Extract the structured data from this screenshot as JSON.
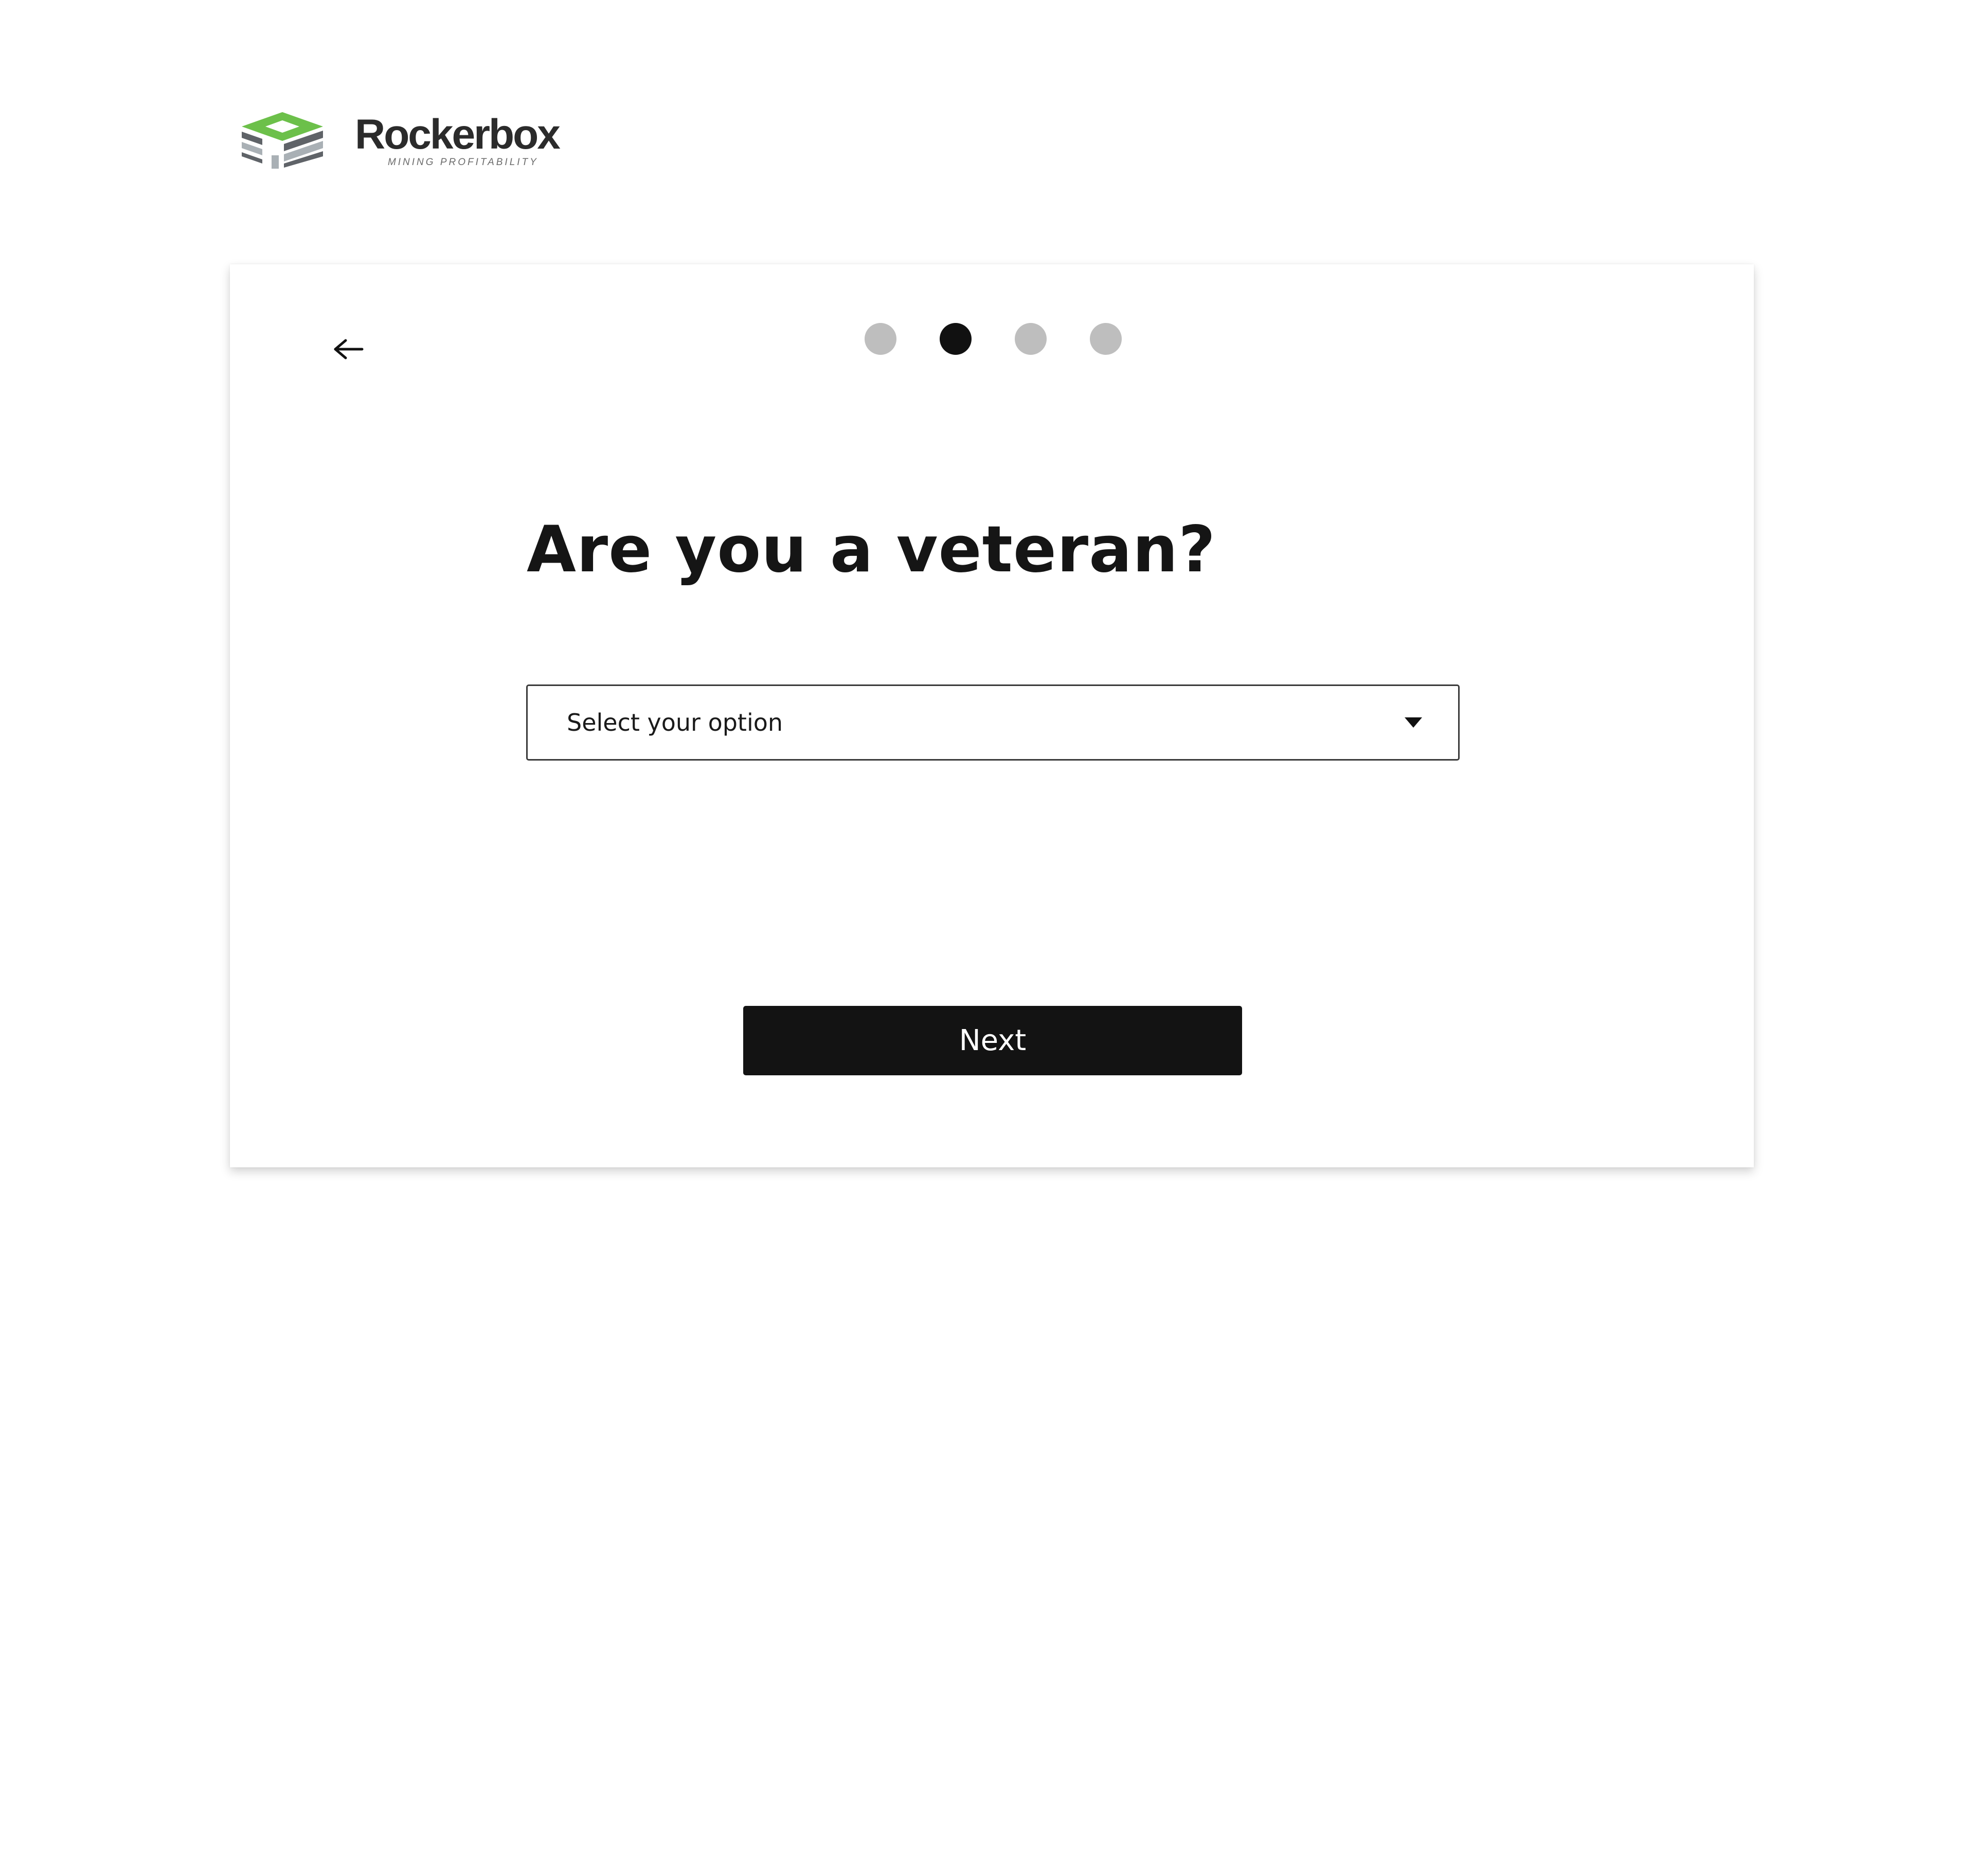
{
  "brand": {
    "name": "Rockerbox",
    "tagline": "MINING PROFITABILITY",
    "colors": {
      "green": "#6cc04a",
      "dark_gray": "#5f6368",
      "light_gray": "#a9b0b5"
    }
  },
  "nav": {
    "back_icon": "arrow-left-icon"
  },
  "stepper": {
    "total_steps": 4,
    "current_step": 2,
    "active_color": "#111111",
    "inactive_color": "#bebebe"
  },
  "question": {
    "title": "Are you a veteran?"
  },
  "select": {
    "selected_text": "Select your option",
    "icon": "caret-down-icon"
  },
  "actions": {
    "next_label": "Next"
  }
}
